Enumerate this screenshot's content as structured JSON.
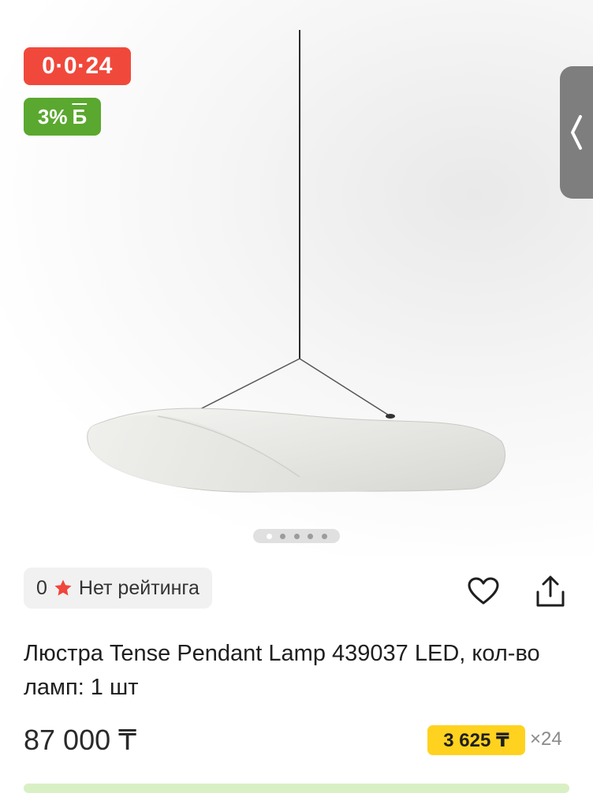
{
  "badges": {
    "installment": "0·0·24",
    "installment_color": "#f0493c",
    "bonus_percent": "3%",
    "bonus_letter": "Б",
    "bonus_color": "#5aa82f"
  },
  "gallery": {
    "total_slides": 5,
    "active_slide": 1,
    "side_tab_icon": "chevron-left-icon"
  },
  "rating": {
    "value": "0",
    "label": "Нет рейтинга",
    "star_color": "#f0453a"
  },
  "actions": {
    "favorite_icon": "heart-icon",
    "share_icon": "share-icon"
  },
  "product": {
    "title": "Люстра Tense Pendant Lamp 439037 LED, кол-во ламп: 1 шт",
    "price": "87 000 ₸",
    "installment_price": "3 625 ₸",
    "installment_count": "×24",
    "installment_color": "#ffd21f"
  }
}
